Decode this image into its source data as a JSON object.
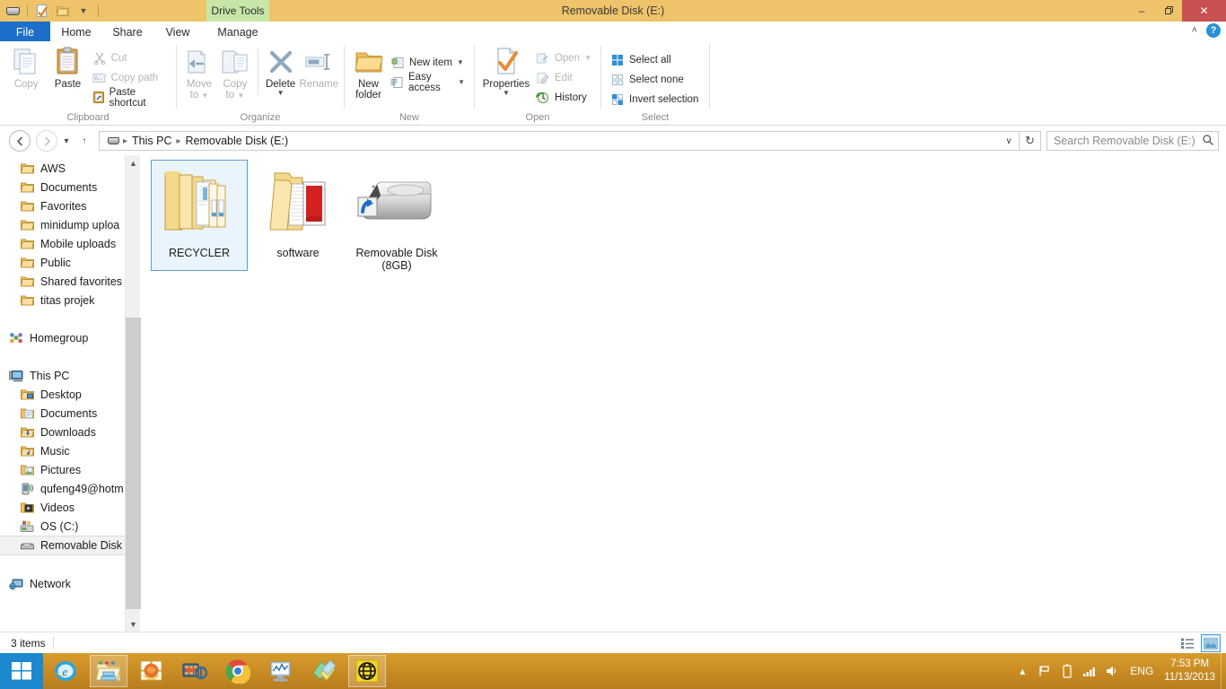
{
  "window": {
    "title": "Removable Disk (E:)",
    "quick_access": [
      "drive-icon",
      "properties-icon",
      "new-folder-icon",
      "customize-dropdown"
    ],
    "controls": {
      "minimize": "–",
      "maximize": "❐",
      "close": "✕"
    }
  },
  "tabs": {
    "file": "File",
    "items": [
      {
        "label": "Home",
        "active": true
      },
      {
        "label": "Share",
        "active": false
      },
      {
        "label": "View",
        "active": false
      },
      {
        "label": "Manage",
        "active": false
      }
    ],
    "contextual_banner": "Drive Tools",
    "collapse_ribbon": "˄",
    "help": "?"
  },
  "ribbon": {
    "groups": [
      {
        "name": "Clipboard",
        "label": "Clipboard",
        "big": [
          {
            "label": "Copy",
            "icon": "copy-icon",
            "dimmed": true
          },
          {
            "label": "Paste",
            "icon": "paste-icon",
            "dimmed": false
          }
        ],
        "small": [
          {
            "label": "Cut",
            "icon": "scissors-icon",
            "dimmed": true
          },
          {
            "label": "Copy path",
            "icon": "copy-path-icon",
            "dimmed": true
          },
          {
            "label": "Paste shortcut",
            "icon": "paste-shortcut-icon",
            "dimmed": false
          }
        ]
      },
      {
        "name": "Organize",
        "label": "Organize",
        "big": [
          {
            "label": "Move\nto",
            "label_line1": "Move",
            "label_line2": "to",
            "icon": "move-to-icon",
            "dimmed": true,
            "caret": true
          },
          {
            "label": "Copy\nto",
            "label_line1": "Copy",
            "label_line2": "to",
            "icon": "copy-to-icon",
            "dimmed": true,
            "caret": true
          },
          {
            "label": "Delete",
            "icon": "delete-icon",
            "dimmed": false,
            "caret": true
          },
          {
            "label": "Rename",
            "icon": "rename-icon",
            "dimmed": true
          }
        ]
      },
      {
        "name": "New",
        "label": "New",
        "big": [
          {
            "label_line1": "New",
            "label_line2": "folder",
            "icon": "new-folder-icon",
            "dimmed": false
          }
        ],
        "small": [
          {
            "label": "New item",
            "icon": "new-item-icon",
            "dimmed": false,
            "caret": true
          },
          {
            "label": "Easy access",
            "icon": "easy-access-icon",
            "dimmed": false,
            "caret": true
          }
        ]
      },
      {
        "name": "Open",
        "label": "Open",
        "big": [
          {
            "label": "Properties",
            "icon": "properties-icon",
            "dimmed": false,
            "caret": true
          }
        ],
        "small": [
          {
            "label": "Open",
            "icon": "open-icon",
            "dimmed": true,
            "caret": true
          },
          {
            "label": "Edit",
            "icon": "edit-icon",
            "dimmed": true
          },
          {
            "label": "History",
            "icon": "history-icon",
            "dimmed": false
          }
        ]
      },
      {
        "name": "Select",
        "label": "Select",
        "small": [
          {
            "label": "Select all",
            "icon": "select-all-icon",
            "dimmed": false
          },
          {
            "label": "Select none",
            "icon": "select-none-icon",
            "dimmed": false
          },
          {
            "label": "Invert selection",
            "icon": "invert-selection-icon",
            "dimmed": false
          }
        ]
      }
    ]
  },
  "address": {
    "back": "←",
    "forward": "→",
    "recent_dropdown": "▾",
    "up": "↑",
    "breadcrumbs": [
      "This PC",
      "Removable Disk (E:)"
    ],
    "separator": "▸",
    "dropdown": "∨",
    "refresh": "↻",
    "search_placeholder": "Search Removable Disk (E:)",
    "search_value": "",
    "search_icon": "magnifier-icon"
  },
  "sidebar": {
    "groups": [
      {
        "items": [
          {
            "label": "AWS",
            "icon": "folder-icon",
            "indent": true
          },
          {
            "label": "Documents",
            "icon": "folder-icon",
            "indent": true
          },
          {
            "label": "Favorites",
            "icon": "folder-icon",
            "indent": true
          },
          {
            "label": "minidump uploa",
            "icon": "folder-icon",
            "indent": true
          },
          {
            "label": "Mobile uploads",
            "icon": "folder-icon",
            "indent": true
          },
          {
            "label": "Public",
            "icon": "folder-icon",
            "indent": true
          },
          {
            "label": "Shared favorites",
            "icon": "folder-icon",
            "indent": true
          },
          {
            "label": "titas projek",
            "icon": "folder-icon",
            "indent": true
          }
        ]
      },
      {
        "items": [
          {
            "label": "Homegroup",
            "icon": "homegroup-icon",
            "root": true
          }
        ]
      },
      {
        "items": [
          {
            "label": "This PC",
            "icon": "computer-icon",
            "root": true
          },
          {
            "label": "Desktop",
            "icon": "desktop-folder-icon",
            "indent": true
          },
          {
            "label": "Documents",
            "icon": "documents-folder-icon",
            "indent": true
          },
          {
            "label": "Downloads",
            "icon": "downloads-folder-icon",
            "indent": true
          },
          {
            "label": "Music",
            "icon": "music-folder-icon",
            "indent": true
          },
          {
            "label": "Pictures",
            "icon": "pictures-folder-icon",
            "indent": true
          },
          {
            "label": "qufeng49@hotm",
            "icon": "phone-icon",
            "indent": true
          },
          {
            "label": "Videos",
            "icon": "videos-folder-icon",
            "indent": true
          },
          {
            "label": "OS (C:)",
            "icon": "harddrive-icon",
            "indent": true
          },
          {
            "label": "Removable Disk (",
            "icon": "removable-drive-icon",
            "indent": true,
            "selected": true
          }
        ]
      },
      {
        "items": [
          {
            "label": "Network",
            "icon": "network-icon",
            "root": true
          }
        ]
      }
    ]
  },
  "files": {
    "items": [
      {
        "name": "RECYCLER",
        "icon": "multi-folder-icon",
        "selected": true
      },
      {
        "name": "software",
        "icon": "folder-with-docs-icon",
        "selected": false
      },
      {
        "name": "Removable Disk",
        "name_line2": "(8GB)",
        "icon": "removable-drive-shortcut-icon",
        "selected": false
      }
    ]
  },
  "status": {
    "item_count": "3 items",
    "views": [
      {
        "name": "details-view",
        "active": false
      },
      {
        "name": "large-icons-view",
        "active": true
      }
    ]
  },
  "taskbar": {
    "start": "windows-logo-icon",
    "items": [
      {
        "name": "internet-explorer-icon",
        "running": false
      },
      {
        "name": "file-explorer-icon",
        "running": true
      },
      {
        "name": "windows-photo-viewer-icon",
        "running": false
      },
      {
        "name": "windows-movie-maker-icon",
        "running": false
      },
      {
        "name": "google-chrome-icon",
        "running": false
      },
      {
        "name": "resource-monitor-icon",
        "running": false
      },
      {
        "name": "sticky-notes-icon",
        "running": false
      },
      {
        "name": "globe-app-icon",
        "running": true
      }
    ],
    "tray": {
      "show_hidden": "▴",
      "icons": [
        "flag-icon",
        "battery-icon",
        "network-signal-icon",
        "volume-icon"
      ],
      "language": "ENG",
      "time": "7:53 PM",
      "date": "11/13/2013"
    }
  },
  "colors": {
    "title_bar": "#efc36a",
    "file_tab": "#1c6fc9",
    "close_button": "#c75050",
    "contextual_tab": "#c8e6a8",
    "taskbar": "#c98c24",
    "start_button": "#1b88d0",
    "selection": "#eaf4fd",
    "selection_border": "#5a9ed6"
  }
}
